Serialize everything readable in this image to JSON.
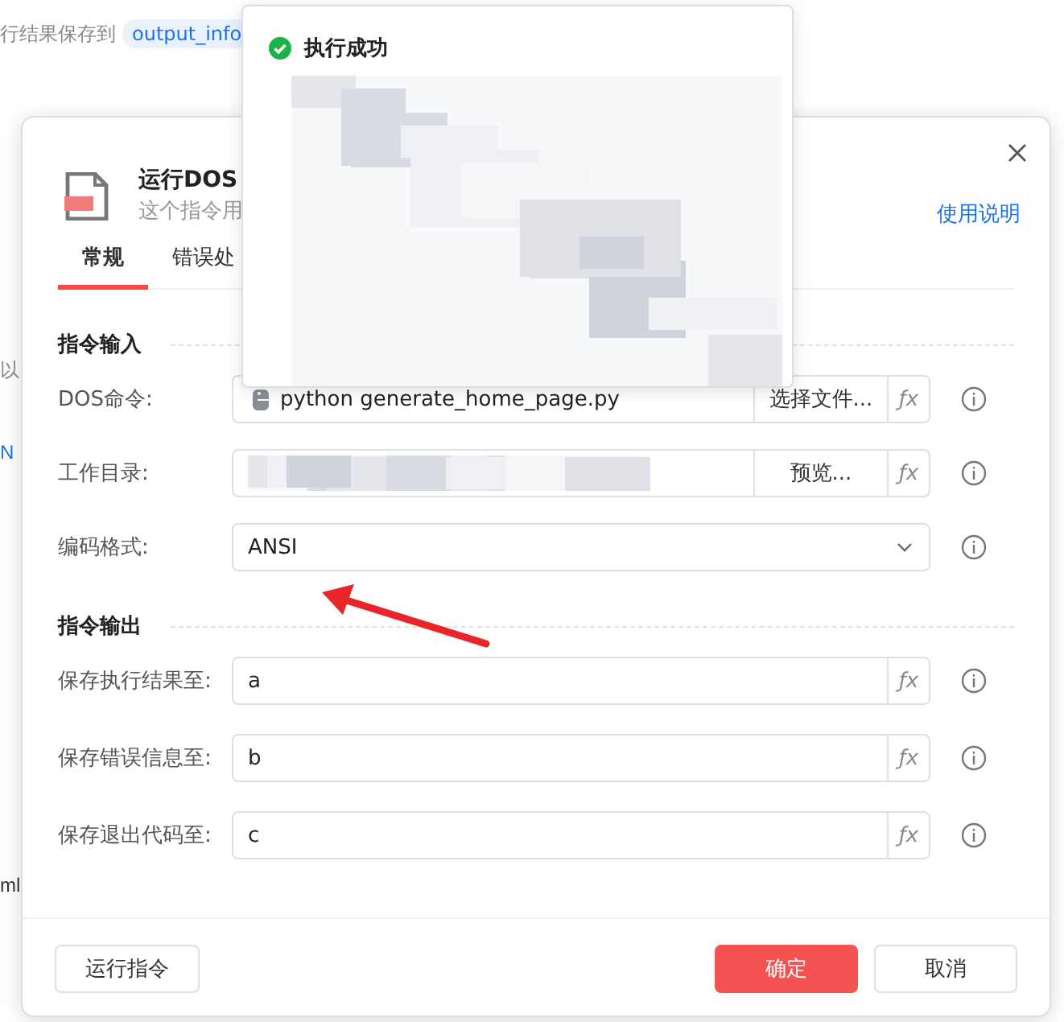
{
  "background": {
    "line": "行结果保存到",
    "variable": "output_info",
    "fragments": [
      {
        "text": "以",
        "kind": "plain"
      },
      {
        "text": "N",
        "kind": "link"
      },
      {
        "text": "ml",
        "kind": "plain"
      }
    ]
  },
  "dialog": {
    "title": "运行DOS",
    "subtitle": "这个指令用",
    "help_link": "使用说明",
    "tabs": [
      {
        "label": "常规",
        "selected": true
      },
      {
        "label": "错误处",
        "selected": false
      }
    ],
    "sections": [
      {
        "title": "指令输入",
        "fields": [
          {
            "kind": "file",
            "label": "DOS命令:",
            "value": "python generate_home_page.py",
            "button": "选择文件...",
            "fx": "ƒx"
          },
          {
            "kind": "folder",
            "label": "工作目录:",
            "button": "预览...",
            "fx": "ƒx"
          },
          {
            "kind": "select",
            "label": "编码格式:",
            "value": "ANSI"
          }
        ]
      },
      {
        "title": "指令输出",
        "fields": [
          {
            "kind": "text",
            "label": "保存执行结果至:",
            "value": "a",
            "fx": "ƒx"
          },
          {
            "kind": "text",
            "label": "保存错误信息至:",
            "value": "b",
            "fx": "ƒx"
          },
          {
            "kind": "text",
            "label": "保存退出代码至:",
            "value": "c",
            "fx": "ƒx"
          }
        ]
      }
    ],
    "buttons": [
      {
        "label": "运行指令",
        "kind": "secondary"
      },
      {
        "label": "确定",
        "kind": "primary"
      },
      {
        "label": "取消",
        "kind": "secondary"
      }
    ]
  },
  "toast": {
    "kind": "success",
    "title": "执行成功"
  }
}
